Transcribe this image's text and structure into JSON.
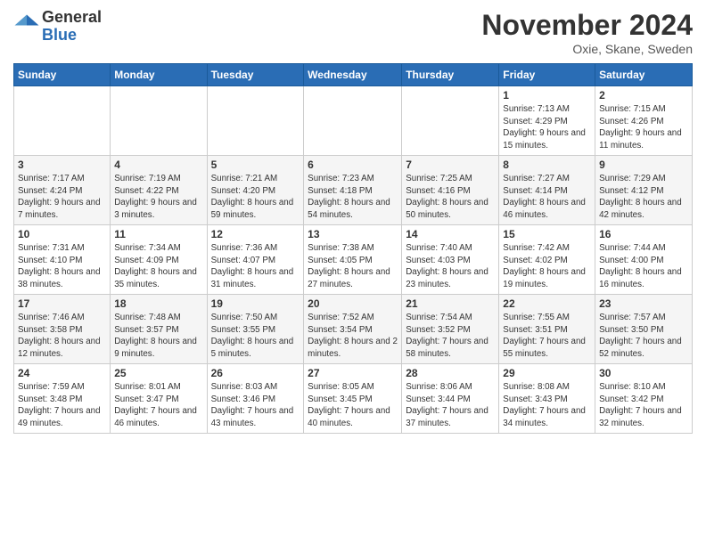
{
  "logo": {
    "general": "General",
    "blue": "Blue"
  },
  "title": "November 2024",
  "location": "Oxie, Skane, Sweden",
  "days_of_week": [
    "Sunday",
    "Monday",
    "Tuesday",
    "Wednesday",
    "Thursday",
    "Friday",
    "Saturday"
  ],
  "weeks": [
    [
      {
        "day": "",
        "info": ""
      },
      {
        "day": "",
        "info": ""
      },
      {
        "day": "",
        "info": ""
      },
      {
        "day": "",
        "info": ""
      },
      {
        "day": "",
        "info": ""
      },
      {
        "day": "1",
        "info": "Sunrise: 7:13 AM\nSunset: 4:29 PM\nDaylight: 9 hours and 15 minutes."
      },
      {
        "day": "2",
        "info": "Sunrise: 7:15 AM\nSunset: 4:26 PM\nDaylight: 9 hours and 11 minutes."
      }
    ],
    [
      {
        "day": "3",
        "info": "Sunrise: 7:17 AM\nSunset: 4:24 PM\nDaylight: 9 hours and 7 minutes."
      },
      {
        "day": "4",
        "info": "Sunrise: 7:19 AM\nSunset: 4:22 PM\nDaylight: 9 hours and 3 minutes."
      },
      {
        "day": "5",
        "info": "Sunrise: 7:21 AM\nSunset: 4:20 PM\nDaylight: 8 hours and 59 minutes."
      },
      {
        "day": "6",
        "info": "Sunrise: 7:23 AM\nSunset: 4:18 PM\nDaylight: 8 hours and 54 minutes."
      },
      {
        "day": "7",
        "info": "Sunrise: 7:25 AM\nSunset: 4:16 PM\nDaylight: 8 hours and 50 minutes."
      },
      {
        "day": "8",
        "info": "Sunrise: 7:27 AM\nSunset: 4:14 PM\nDaylight: 8 hours and 46 minutes."
      },
      {
        "day": "9",
        "info": "Sunrise: 7:29 AM\nSunset: 4:12 PM\nDaylight: 8 hours and 42 minutes."
      }
    ],
    [
      {
        "day": "10",
        "info": "Sunrise: 7:31 AM\nSunset: 4:10 PM\nDaylight: 8 hours and 38 minutes."
      },
      {
        "day": "11",
        "info": "Sunrise: 7:34 AM\nSunset: 4:09 PM\nDaylight: 8 hours and 35 minutes."
      },
      {
        "day": "12",
        "info": "Sunrise: 7:36 AM\nSunset: 4:07 PM\nDaylight: 8 hours and 31 minutes."
      },
      {
        "day": "13",
        "info": "Sunrise: 7:38 AM\nSunset: 4:05 PM\nDaylight: 8 hours and 27 minutes."
      },
      {
        "day": "14",
        "info": "Sunrise: 7:40 AM\nSunset: 4:03 PM\nDaylight: 8 hours and 23 minutes."
      },
      {
        "day": "15",
        "info": "Sunrise: 7:42 AM\nSunset: 4:02 PM\nDaylight: 8 hours and 19 minutes."
      },
      {
        "day": "16",
        "info": "Sunrise: 7:44 AM\nSunset: 4:00 PM\nDaylight: 8 hours and 16 minutes."
      }
    ],
    [
      {
        "day": "17",
        "info": "Sunrise: 7:46 AM\nSunset: 3:58 PM\nDaylight: 8 hours and 12 minutes."
      },
      {
        "day": "18",
        "info": "Sunrise: 7:48 AM\nSunset: 3:57 PM\nDaylight: 8 hours and 9 minutes."
      },
      {
        "day": "19",
        "info": "Sunrise: 7:50 AM\nSunset: 3:55 PM\nDaylight: 8 hours and 5 minutes."
      },
      {
        "day": "20",
        "info": "Sunrise: 7:52 AM\nSunset: 3:54 PM\nDaylight: 8 hours and 2 minutes."
      },
      {
        "day": "21",
        "info": "Sunrise: 7:54 AM\nSunset: 3:52 PM\nDaylight: 7 hours and 58 minutes."
      },
      {
        "day": "22",
        "info": "Sunrise: 7:55 AM\nSunset: 3:51 PM\nDaylight: 7 hours and 55 minutes."
      },
      {
        "day": "23",
        "info": "Sunrise: 7:57 AM\nSunset: 3:50 PM\nDaylight: 7 hours and 52 minutes."
      }
    ],
    [
      {
        "day": "24",
        "info": "Sunrise: 7:59 AM\nSunset: 3:48 PM\nDaylight: 7 hours and 49 minutes."
      },
      {
        "day": "25",
        "info": "Sunrise: 8:01 AM\nSunset: 3:47 PM\nDaylight: 7 hours and 46 minutes."
      },
      {
        "day": "26",
        "info": "Sunrise: 8:03 AM\nSunset: 3:46 PM\nDaylight: 7 hours and 43 minutes."
      },
      {
        "day": "27",
        "info": "Sunrise: 8:05 AM\nSunset: 3:45 PM\nDaylight: 7 hours and 40 minutes."
      },
      {
        "day": "28",
        "info": "Sunrise: 8:06 AM\nSunset: 3:44 PM\nDaylight: 7 hours and 37 minutes."
      },
      {
        "day": "29",
        "info": "Sunrise: 8:08 AM\nSunset: 3:43 PM\nDaylight: 7 hours and 34 minutes."
      },
      {
        "day": "30",
        "info": "Sunrise: 8:10 AM\nSunset: 3:42 PM\nDaylight: 7 hours and 32 minutes."
      }
    ]
  ]
}
